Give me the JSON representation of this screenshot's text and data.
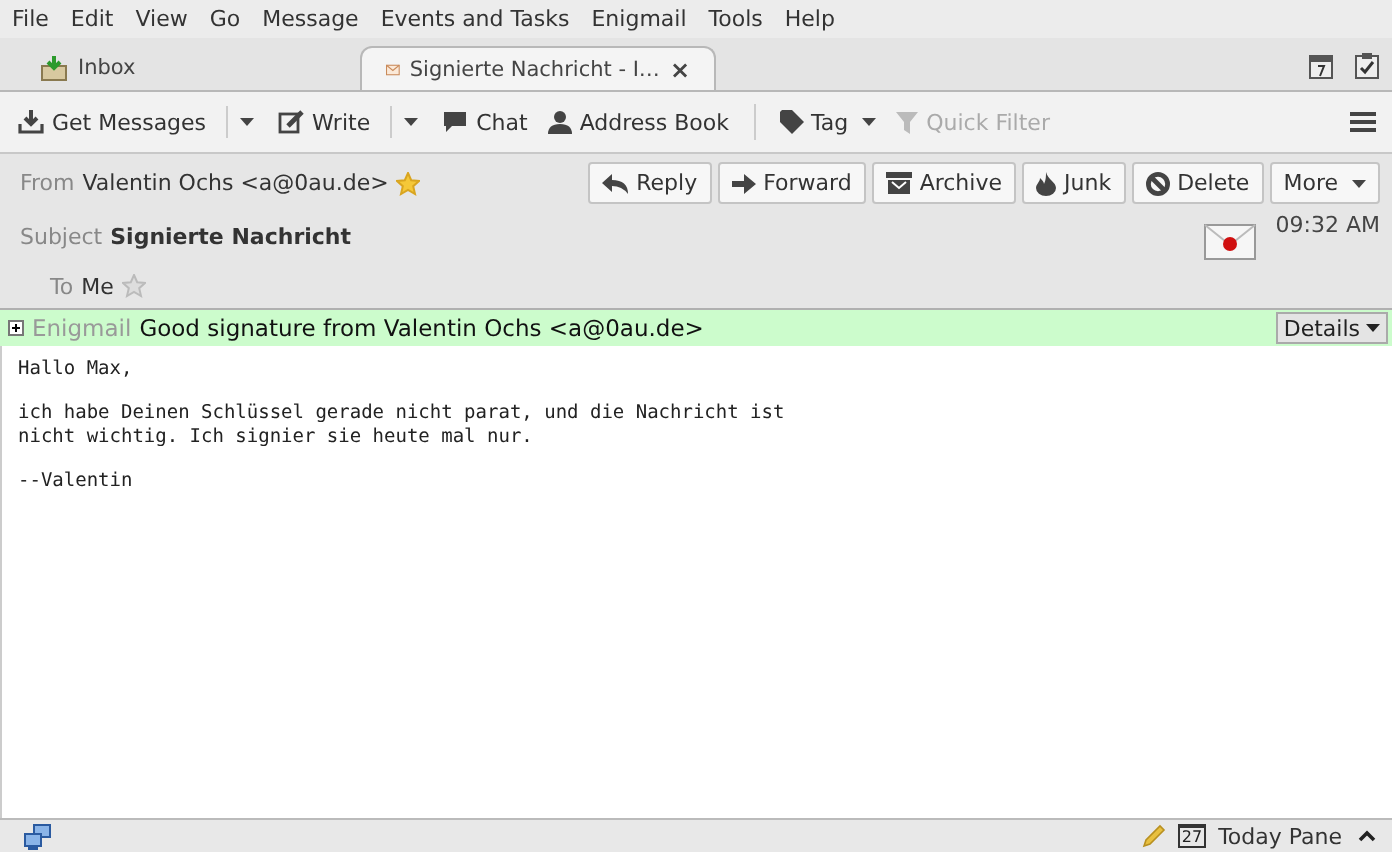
{
  "menu": [
    "File",
    "Edit",
    "View",
    "Go",
    "Message",
    "Events and Tasks",
    "Enigmail",
    "Tools",
    "Help"
  ],
  "tabs": [
    {
      "label": "Inbox",
      "kind": "folder",
      "selected": false
    },
    {
      "label": "Signierte Nachricht - I…",
      "kind": "message",
      "selected": true,
      "close": "×"
    }
  ],
  "toolbar": [
    {
      "label": "Get Messages",
      "kind": "download",
      "split": true,
      "disabled": false
    },
    {
      "label": "Write",
      "kind": "write",
      "split": true,
      "disabled": false
    },
    {
      "label": "Chat",
      "kind": "chat",
      "split": false,
      "disabled": false
    },
    {
      "label": "Address Book",
      "kind": "contact",
      "split": false,
      "disabled": false
    },
    {
      "label": "Tag",
      "kind": "tag",
      "split": false,
      "dropdown": true,
      "disabled": false
    },
    {
      "label": "Quick Filter",
      "kind": "filter",
      "split": false,
      "disabled": true
    }
  ],
  "header": {
    "from_label": "From",
    "from": "Valentin Ochs <a@0au.de>",
    "from_starred": true,
    "subject_label": "Subject",
    "subject": "Signierte Nachricht",
    "to_label": "To",
    "to": "Me",
    "to_starred": false,
    "time": "09:32 AM",
    "buttons": [
      {
        "label": "Reply",
        "kind": "reply"
      },
      {
        "label": "Forward",
        "kind": "forward"
      },
      {
        "label": "Archive",
        "kind": "archive"
      },
      {
        "label": "Junk",
        "kind": "junk"
      },
      {
        "label": "Delete",
        "kind": "delete"
      },
      {
        "label": "More",
        "kind": "more"
      }
    ]
  },
  "enigmail": {
    "expanded": false,
    "label": "Enigmail",
    "status": "Good signature from Valentin Ochs <a@0au.de>",
    "details": "Details"
  },
  "body": [
    "Hallo Max,",
    "ich habe Deinen Schlüssel gerade nicht parat, und die Nachricht ist\nnicht wichtig. Ich signier sie heute mal nur.",
    "--Valentin"
  ],
  "status_bar": {
    "calendar_day": "27",
    "today_pane": "Today Pane",
    "today_pane_open": false
  }
}
